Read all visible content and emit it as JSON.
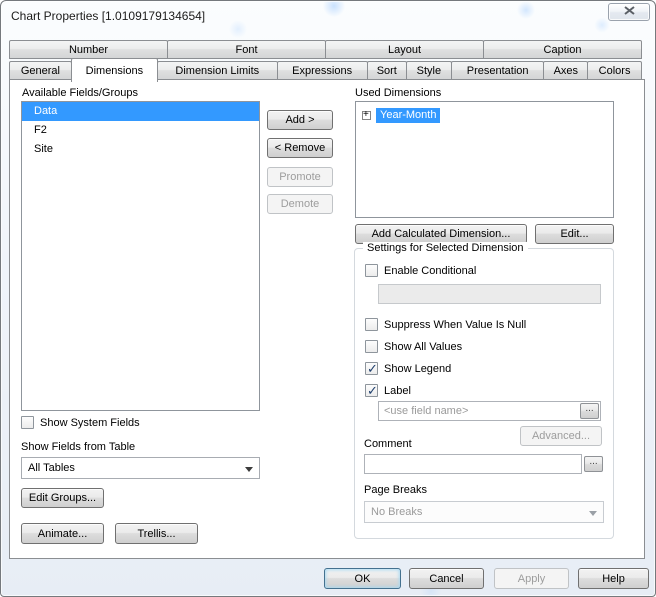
{
  "window": {
    "title": "Chart Properties [1.0109179134654]"
  },
  "colors": {
    "selection": "#3399ff"
  },
  "tabs_top": [
    "Number",
    "Font",
    "Layout",
    "Caption"
  ],
  "tabs_bottom": [
    "General",
    "Dimensions",
    "Dimension Limits",
    "Expressions",
    "Sort",
    "Style",
    "Presentation",
    "Axes",
    "Colors"
  ],
  "active_tab": "Dimensions",
  "left": {
    "available_fields_label": "Available Fields/Groups",
    "fields": [
      "Data",
      "F2",
      "Site"
    ],
    "selected_field": "Data",
    "add_button": "Add >",
    "remove_button": "< Remove",
    "promote_button": "Promote",
    "demote_button": "Demote",
    "show_system_fields_label": "Show System Fields",
    "show_fields_from_table_label": "Show Fields from Table",
    "table_filter_value": "All Tables",
    "edit_groups_button": "Edit Groups...",
    "animate_button": "Animate...",
    "trellis_button": "Trellis..."
  },
  "right": {
    "used_dimensions_label": "Used Dimensions",
    "used_dimensions": [
      "Year-Month"
    ],
    "selected_dimension": "Year-Month",
    "add_calculated_button": "Add Calculated Dimension...",
    "edit_button": "Edit...",
    "settings_group_label": "Settings for Selected Dimension",
    "enable_conditional_label": "Enable Conditional",
    "conditional_value": "",
    "suppress_null_label": "Suppress When Value Is Null",
    "show_all_values_label": "Show All Values",
    "show_legend_label": "Show Legend",
    "label_label": "Label",
    "label_placeholder": "<use field name>",
    "ellipsis_button": "...",
    "advanced_button": "Advanced...",
    "comment_label": "Comment",
    "comment_value": "",
    "page_breaks_label": "Page Breaks",
    "page_breaks_value": "No Breaks"
  },
  "states": {
    "enable_conditional": false,
    "suppress_when_value_is_null": false,
    "show_all_values": false,
    "show_legend": true,
    "label": true,
    "show_system_fields": false
  },
  "footer": {
    "ok_button": "OK",
    "cancel_button": "Cancel",
    "apply_button": "Apply",
    "help_button": "Help"
  }
}
